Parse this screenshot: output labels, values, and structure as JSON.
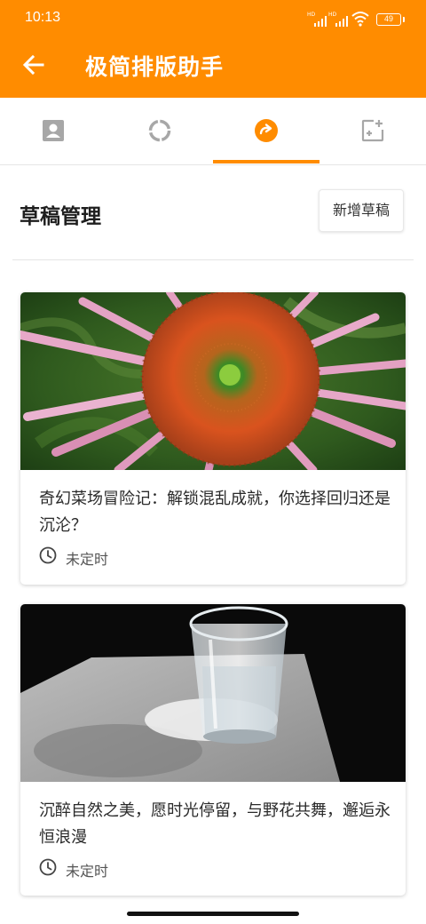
{
  "status_bar": {
    "time": "10:13",
    "signal_label": "HD",
    "battery": "49"
  },
  "app_bar": {
    "title": "极简排版助手",
    "back_icon": "arrow-left-icon"
  },
  "tabs": [
    {
      "icon": "contact-card-icon",
      "active": false
    },
    {
      "icon": "progress-ring-icon",
      "active": false
    },
    {
      "icon": "redo-circle-icon",
      "active": true
    },
    {
      "icon": "add-photo-icon",
      "active": false
    }
  ],
  "section": {
    "title": "草稿管理",
    "new_button": "新增草稿"
  },
  "drafts": [
    {
      "title": "奇幻菜场冒险记：解锁混乱成就，你选择回归还是沉沦？",
      "status": "未定时",
      "image": "coneflower-photo"
    },
    {
      "title": "沉醉自然之美，愿时光停留，与野花共舞，邂逅永恒浪漫",
      "status": "未定时",
      "image": "water-glass-photo"
    }
  ],
  "colors": {
    "accent": "#ff8c00",
    "background": "#ffffff",
    "text": "#222222"
  }
}
